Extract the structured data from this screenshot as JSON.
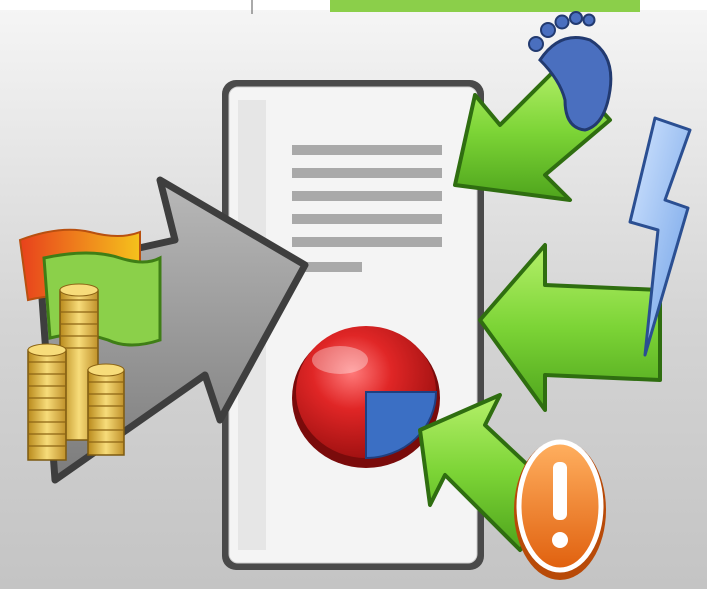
{
  "illustration": {
    "icons": {
      "document": "document-icon",
      "pie_chart": "pie-chart-icon",
      "money": "money-icon",
      "footprint": "footprint-icon",
      "lightning": "lightning-icon",
      "warning": "warning-icon",
      "incoming_arrow": "arrow-icon"
    },
    "colors": {
      "background": "#c9c9c9",
      "document": "#f2f2f2",
      "gray_arrow": "#8f8f8f",
      "green_arrow": "#7cd436",
      "pie_red": "#d81e1e",
      "pie_blue": "#3b6fc4",
      "lightning": "#8fb8ef",
      "footprint": "#4a6fbf",
      "warning": "#f07a1c",
      "coins": "#e9c44a",
      "flag_front": "#8bd04a",
      "flag_back": "#f0a020"
    },
    "pie_chart": {
      "minor_slice_fraction": 0.25
    },
    "text_lines_on_document": 6
  }
}
